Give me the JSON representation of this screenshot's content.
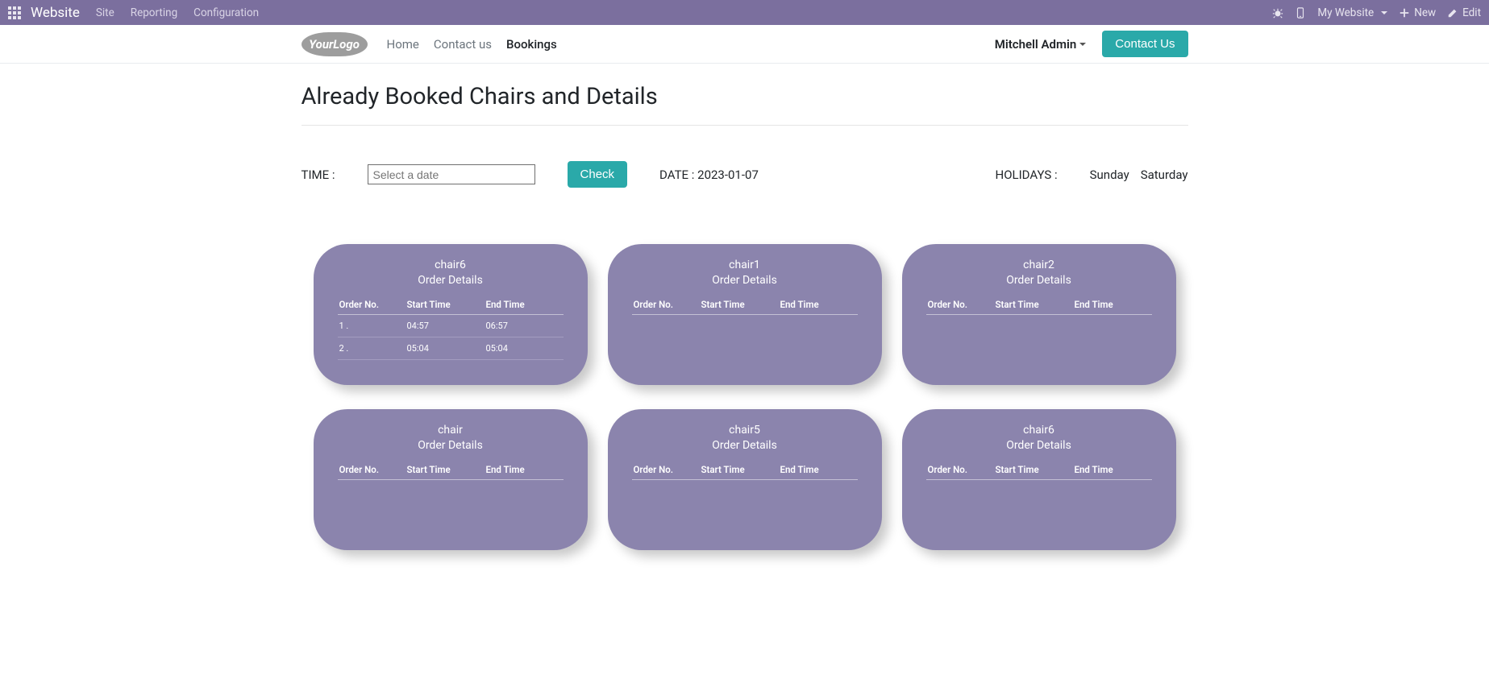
{
  "topbar": {
    "app_name": "Website",
    "menu": [
      "Site",
      "Reporting",
      "Configuration"
    ],
    "my_website": "My Website",
    "new": "New",
    "edit": "Edit"
  },
  "navbar": {
    "logo_text": "YourLogo",
    "links": [
      "Home",
      "Contact us",
      "Bookings"
    ],
    "active_index": 2,
    "user": "Mitchell Admin",
    "contact_btn": "Contact Us"
  },
  "page": {
    "title": "Already Booked Chairs and Details",
    "time_label": "TIME :",
    "date_placeholder": "Select a date",
    "check_btn": "Check",
    "date_label": "DATE : ",
    "date_value": "2023-01-07",
    "holidays_label": "HOLIDAYS :",
    "holidays": [
      "Sunday",
      "Saturday"
    ]
  },
  "card_labels": {
    "order_details": "Order Details",
    "order_no": "Order No.",
    "start_time": "Start Time",
    "end_time": "End Time"
  },
  "cards": [
    {
      "name": "chair6",
      "rows": [
        {
          "no": "1 .",
          "start": "04:57",
          "end": "06:57"
        },
        {
          "no": "2 .",
          "start": "05:04",
          "end": "05:04"
        }
      ]
    },
    {
      "name": "chair1",
      "rows": []
    },
    {
      "name": "chair2",
      "rows": []
    },
    {
      "name": "chair",
      "rows": []
    },
    {
      "name": "chair5",
      "rows": []
    },
    {
      "name": "chair6",
      "rows": []
    }
  ],
  "colors": {
    "topbar": "#7b6f9e",
    "card": "#8b84ad",
    "teal": "#2aa9a9"
  }
}
